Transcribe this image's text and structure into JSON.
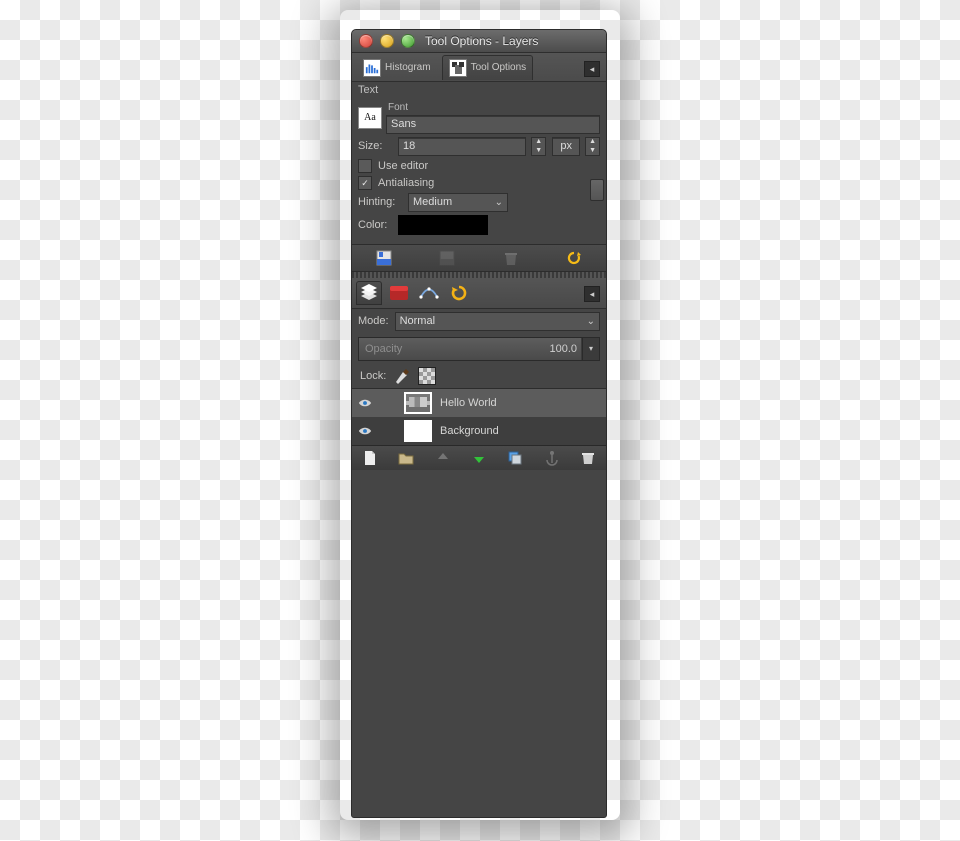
{
  "window": {
    "title": "Tool Options - Layers"
  },
  "tabs": {
    "histogram": "Histogram",
    "tool_options": "Tool Options"
  },
  "text_tool": {
    "section": "Text",
    "font_caption": "Font",
    "font_value": "Sans",
    "size_label": "Size:",
    "size_value": "18",
    "size_unit": "px",
    "use_editor": "Use editor",
    "antialias": "Antialiasing",
    "hinting_label": "Hinting:",
    "hinting_value": "Medium",
    "color_label": "Color:",
    "color_value": "#000000"
  },
  "layers": {
    "mode_label": "Mode:",
    "mode_value": "Normal",
    "opacity_label": "Opacity",
    "opacity_value": "100.0",
    "lock_label": "Lock:",
    "items": [
      {
        "name": "Hello World",
        "visible": true,
        "selected": true,
        "kind": "text"
      },
      {
        "name": "Background",
        "visible": true,
        "selected": false,
        "kind": "white"
      }
    ]
  }
}
